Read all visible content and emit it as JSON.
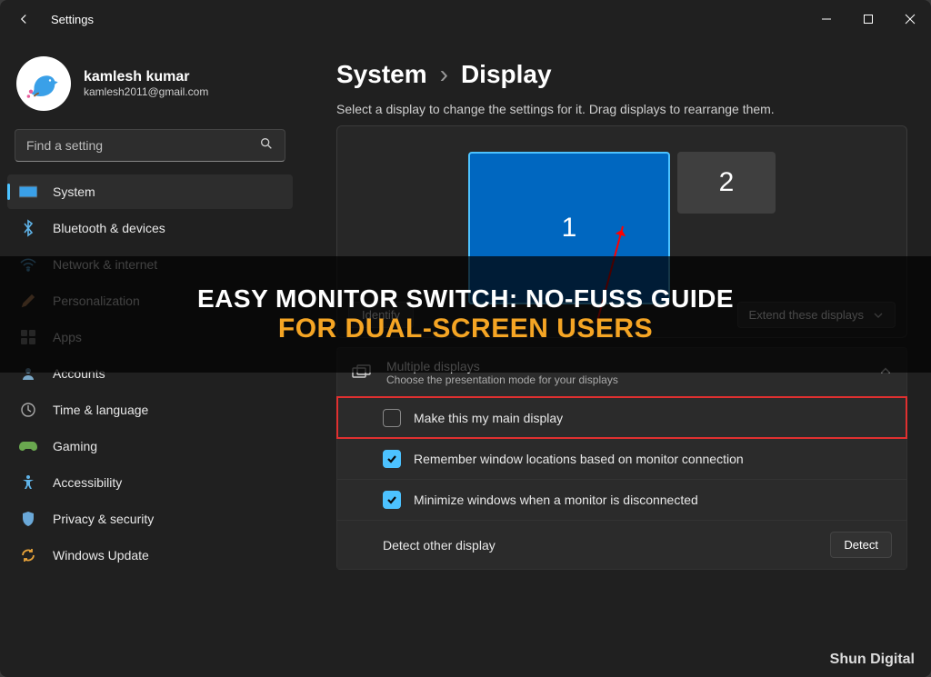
{
  "titlebar": {
    "title": "Settings"
  },
  "profile": {
    "name": "kamlesh kumar",
    "email": "kamlesh2011@gmail.com"
  },
  "search": {
    "placeholder": "Find a setting"
  },
  "nav": {
    "items": [
      {
        "label": "System"
      },
      {
        "label": "Bluetooth & devices"
      },
      {
        "label": "Network & internet"
      },
      {
        "label": "Personalization"
      },
      {
        "label": "Apps"
      },
      {
        "label": "Accounts"
      },
      {
        "label": "Time & language"
      },
      {
        "label": "Gaming"
      },
      {
        "label": "Accessibility"
      },
      {
        "label": "Privacy & security"
      },
      {
        "label": "Windows Update"
      }
    ]
  },
  "breadcrumb": {
    "root": "System",
    "current": "Display"
  },
  "main": {
    "select_hint": "Select a display to change the settings for it. Drag displays to rearrange them.",
    "monitors": {
      "m1": "1",
      "m2": "2"
    },
    "identify": "Identify",
    "extend_mode": "Extend these displays",
    "multiple": {
      "title": "Multiple displays",
      "sub": "Choose the presentation mode for your displays"
    },
    "opts": {
      "main": "Make this my main display",
      "remember": "Remember window locations based on monitor connection",
      "minimize": "Minimize windows when a monitor is disconnected",
      "detect_label": "Detect other display",
      "detect_btn": "Detect"
    }
  },
  "overlay": {
    "line1": "EASY MONITOR SWITCH: NO-FUSS GUIDE",
    "line2": "FOR DUAL-SCREEN USERS"
  },
  "watermark": "Shun Digital"
}
